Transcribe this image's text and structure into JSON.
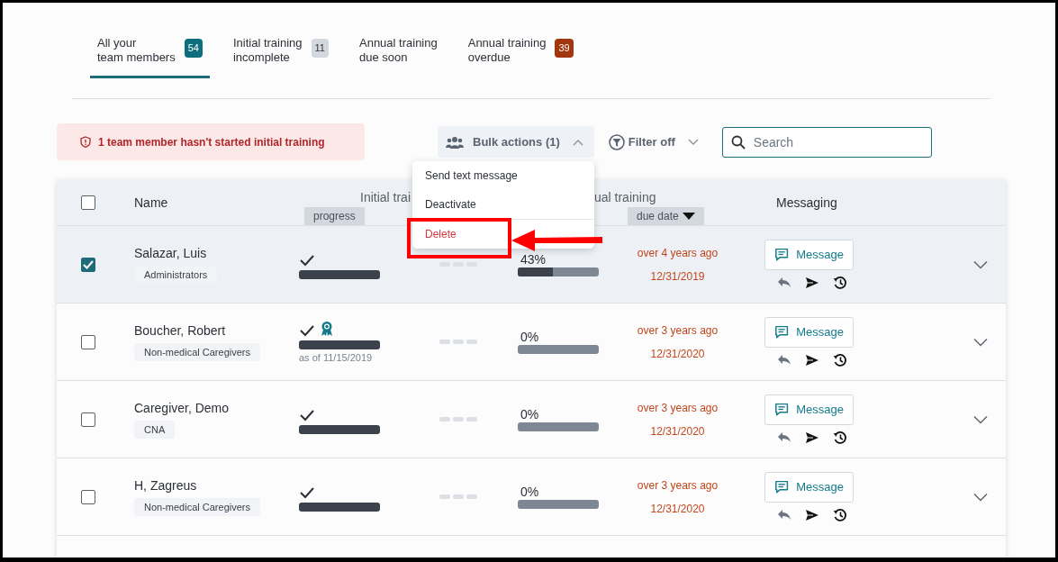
{
  "tabs": [
    {
      "label": "All your\nteam members",
      "selected": true,
      "badge": {
        "text": "54",
        "color": "#0e6e7e"
      }
    },
    {
      "label": "Initial training\nincomplete",
      "selected": false,
      "badge": {
        "text": "11",
        "color": "#d3d8df"
      }
    },
    {
      "label": "Annual training\ndue soon",
      "selected": false
    },
    {
      "label": "Annual training\noverdue",
      "selected": false,
      "badge": {
        "text": "39",
        "color": "#a3350f"
      }
    }
  ],
  "alert": {
    "text": "1 team member hasn't started initial training"
  },
  "bulk_actions": {
    "label": "Bulk actions (1)",
    "expanded": true,
    "menu": [
      {
        "label": "Send text message",
        "kind": "normal"
      },
      {
        "label": "Deactivate",
        "kind": "normal"
      },
      {
        "label": "Delete",
        "kind": "danger"
      }
    ]
  },
  "filter": {
    "label": "Filter off"
  },
  "search": {
    "placeholder": "Search"
  },
  "table": {
    "select_all": {
      "checked": false
    },
    "columns": {
      "name": "Name",
      "initial_group": "Initial trai",
      "initial_sub": "progress",
      "annual_group": "ual training",
      "annual_sub": {
        "label": "due date",
        "sort_descending": true
      },
      "messaging": "Messaging"
    },
    "rows": [
      {
        "name": "Salazar, Luis",
        "group": "Administrators",
        "selected": true,
        "initial": {
          "complete": true,
          "certified": false,
          "level": 1
        },
        "annual": {
          "percent": "43%",
          "level": 0.43
        },
        "due": {
          "relative": "over 4 years ago",
          "date": "12/31/2019"
        },
        "message": "Message"
      },
      {
        "name": "Boucher, Robert",
        "group": "Non-medical Caregivers",
        "selected": false,
        "initial": {
          "complete": true,
          "certified": true,
          "level": 1,
          "as_of": "as of 11/15/2019"
        },
        "annual": {
          "percent": "0%",
          "level": 0
        },
        "due": {
          "relative": "over 3 years ago",
          "date": "12/31/2020"
        },
        "message": "Message"
      },
      {
        "name": "Caregiver, Demo",
        "group": "CNA",
        "selected": false,
        "initial": {
          "complete": true,
          "certified": false,
          "level": 1
        },
        "annual": {
          "percent": "0%",
          "level": 0
        },
        "due": {
          "relative": "over 3 years ago",
          "date": "12/31/2020"
        },
        "message": "Message"
      },
      {
        "name": "H, Zagreus",
        "group": "Non-medical Caregivers",
        "selected": false,
        "initial": {
          "complete": true,
          "certified": false,
          "level": 1
        },
        "annual": {
          "percent": "0%",
          "level": 0
        },
        "due": {
          "relative": "over 3 years ago",
          "date": "12/31/2020"
        },
        "message": "Message"
      }
    ]
  }
}
